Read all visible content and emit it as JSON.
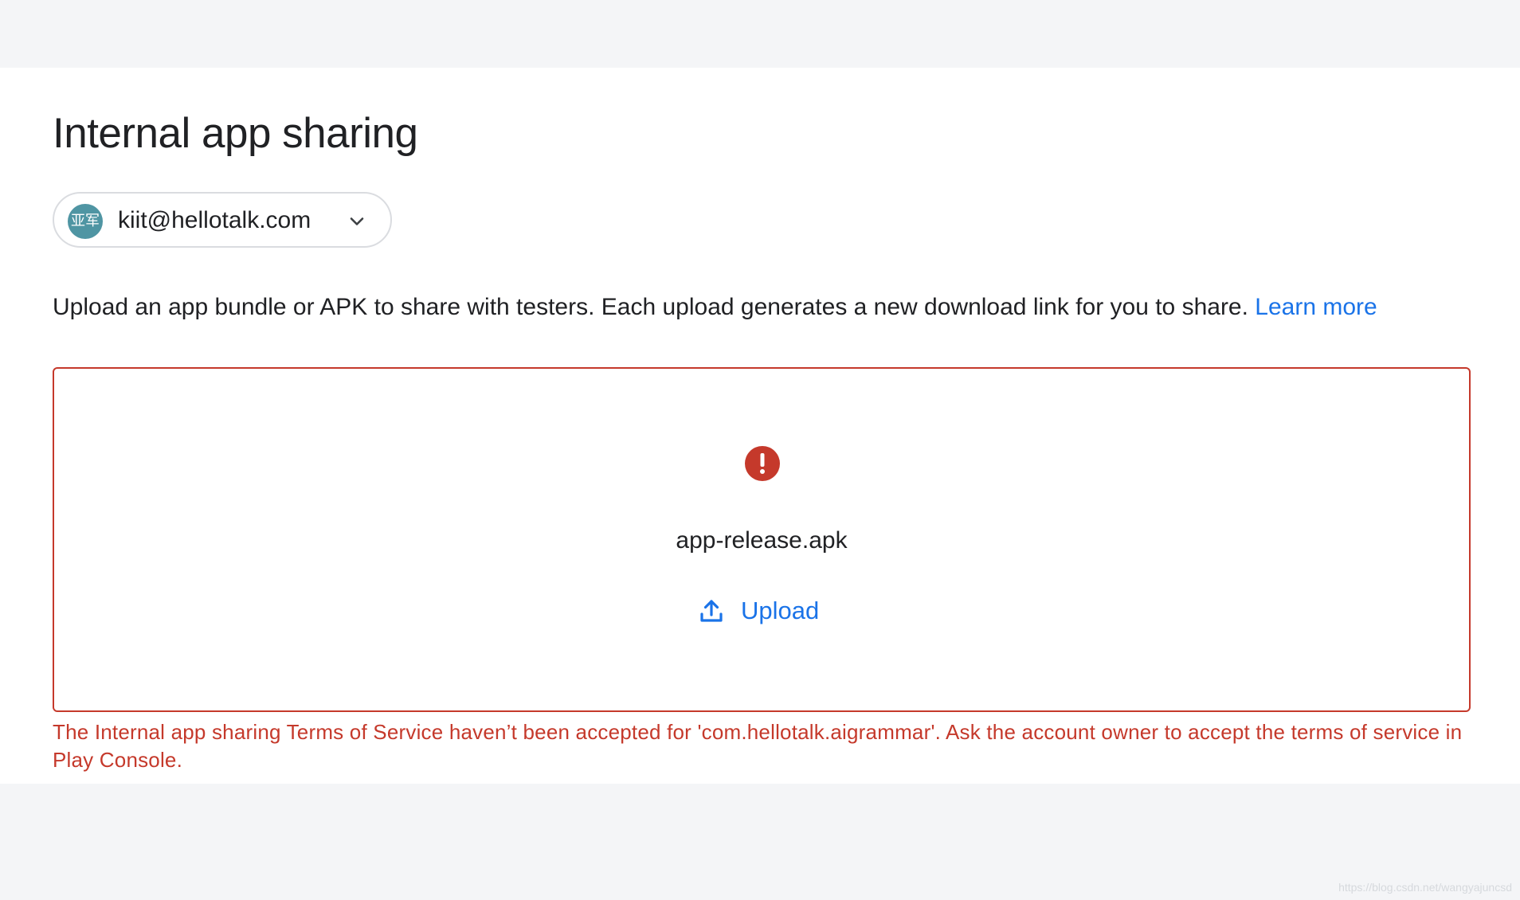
{
  "page": {
    "title": "Internal app sharing"
  },
  "account": {
    "avatar_text": "亚军",
    "email": "kiit@hellotalk.com",
    "dropdown_icon": "chevron-down-icon",
    "avatar_color": "#4f95a3"
  },
  "description": {
    "text": "Upload an app bundle or APK to share with testers. Each upload generates a new download link for you to share. ",
    "learn_more_label": "Learn more"
  },
  "upload_area": {
    "status_icon": "error-icon",
    "file_name": "app-release.apk",
    "upload_label": "Upload",
    "upload_icon": "upload-icon",
    "error_color": "#c5392b",
    "accent_color": "#1a73e8"
  },
  "error": {
    "message": "The Internal app sharing Terms of Service haven’t been accepted for 'com.hellotalk.aigrammar'. Ask the account owner to accept the terms of service in Play Console."
  },
  "watermark": {
    "text": "https://blog.csdn.net/wangyajuncsd"
  }
}
